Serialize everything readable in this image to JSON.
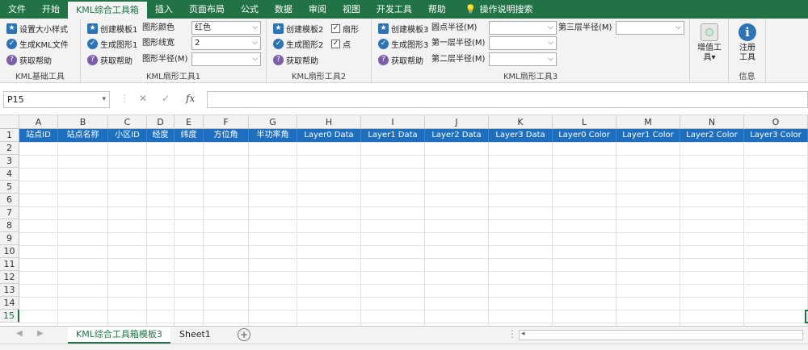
{
  "tabs": [
    "文件",
    "开始",
    "KML综合工具箱",
    "插入",
    "页面布局",
    "公式",
    "数据",
    "审阅",
    "视图",
    "开发工具",
    "帮助"
  ],
  "tell_me": "操作说明搜索",
  "grp1": {
    "btn1": "设置大小样式",
    "btn2": "生成KML文件",
    "btn3": "获取帮助",
    "label": "KML基础工具"
  },
  "grp2": {
    "btn1": "创建模板1",
    "btn2": "生成图形1",
    "btn3": "获取帮助",
    "lbl1": "图形颜色",
    "val1": "红色",
    "lbl2": "图形线宽",
    "val2": "2",
    "lbl3": "图形半径(M)",
    "val3": "",
    "label": "KML扇形工具1"
  },
  "grp3": {
    "btn1": "创建模板2",
    "btn2": "生成图形2",
    "btn3": "获取帮助",
    "cb1": "扇形",
    "cb2": "点",
    "label": "KML扇形工具2"
  },
  "grp4": {
    "btn1": "创建模板3",
    "btn2": "生成图形3",
    "btn3": "获取帮助",
    "lbl1": "圆点半径(M)",
    "lbl2": "第一层半径(M)",
    "lbl3": "第二层半径(M)",
    "lbl4": "第三层半径(M)",
    "label": "KML扇形工具3"
  },
  "addon": {
    "label1": "增值工",
    "label2": "具",
    "arrow": "▾"
  },
  "reg": {
    "label1": "注册",
    "label2": "工具",
    "group": "信息"
  },
  "namebox": "P15",
  "fx": "fx",
  "columns": [
    "A",
    "B",
    "C",
    "D",
    "E",
    "F",
    "G",
    "H",
    "I",
    "J",
    "K",
    "L",
    "M",
    "N",
    "O"
  ],
  "headers": [
    "站点ID",
    "站点名称",
    "小区ID",
    "经度",
    "纬度",
    "方位角",
    "半功率角",
    "Layer0 Data",
    "Layer1 Data",
    "Layer2 Data",
    "Layer3 Data",
    "Layer0 Color",
    "Layer1 Color",
    "Layer2 Color",
    "Layer3 Color"
  ],
  "rows": [
    "1",
    "2",
    "3",
    "4",
    "5",
    "6",
    "7",
    "8",
    "9",
    "10",
    "11",
    "12",
    "13",
    "14",
    "15"
  ],
  "sheets": [
    "KML综合工具箱模板3",
    "Sheet1"
  ],
  "colors": {
    "excel_green": "#217346",
    "header_blue": "#1e6fbf"
  }
}
